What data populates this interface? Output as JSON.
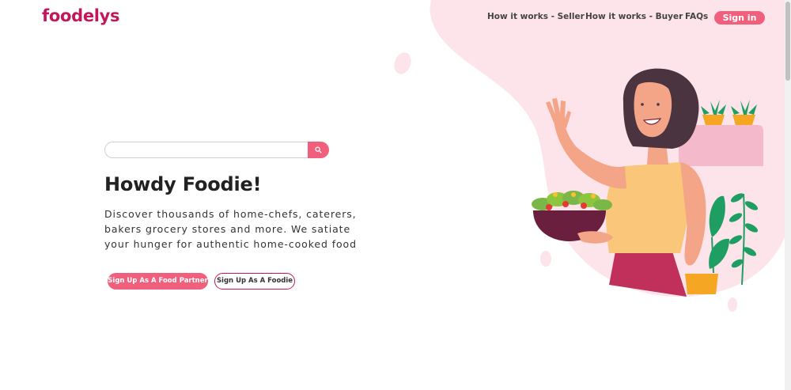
{
  "brand": {
    "logo": "foodelys",
    "accent_color": "#f0607c",
    "brand_color": "#c2185b"
  },
  "nav": {
    "items": [
      {
        "label": "How it works - Seller"
      },
      {
        "label": "How it works - Buyer"
      },
      {
        "label": "FAQs"
      }
    ],
    "signin_label": "Sign in"
  },
  "search": {
    "placeholder": "",
    "value": "",
    "icon": "search-icon"
  },
  "hero": {
    "title": "Howdy Foodie!",
    "description": "Discover thousands of home-chefs, caterers, bakers grocery stores and more. We satiate your hunger for authentic home-cooked food",
    "primary_button": "Sign Up As A Food Partner",
    "secondary_button": "Sign Up As A Foodie"
  },
  "illustration": {
    "icon": "woman-with-salad-illustration"
  }
}
